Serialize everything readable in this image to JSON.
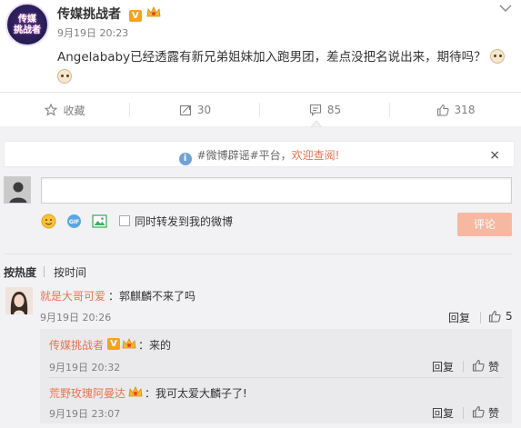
{
  "post": {
    "avatar_text_line1": "传媒",
    "avatar_text_line2": "挑战者",
    "author": "传媒挑战者",
    "verified_badge": "V",
    "time": "9月19日 20:23",
    "text": "Angelababy已经透露有新兄弟姐妹加入跑男团，差点没把名说出来，期待吗？",
    "menu_icon": "chevron-down-icon"
  },
  "actions": {
    "favorite_label": "收藏",
    "repost_count": "30",
    "comment_count": "85",
    "like_count": "318"
  },
  "comments_panel": {
    "rumor_notice_prefix": "#微博辟谣#平台，",
    "rumor_notice_link": "欢迎查阅!",
    "close_icon": "×",
    "input_value": "",
    "repost_checkbox_label": "同时转发到我的微博",
    "submit_label": "评论",
    "sort_hot": "按热度",
    "sort_time": "按时间"
  },
  "comments": [
    {
      "user": "就是大哥可爱",
      "text": "：郭麒麟不来了吗",
      "time": "9月19日 20:26",
      "reply_label": "回复",
      "likes": "5",
      "replies": [
        {
          "user": "传媒挑战者",
          "badge": "V",
          "text": "：来的",
          "time": "9月19日 20:32",
          "reply_label": "回复",
          "like_label": "赞"
        },
        {
          "user": "荒野玫瑰阿曼达",
          "badge": "",
          "text": "：我可太爱大麟子了!",
          "time": "9月19日 23:07",
          "reply_label": "回复",
          "like_label": "赞"
        }
      ]
    }
  ],
  "colors": {
    "accent_orange": "#eb7350",
    "badge_gold": "#f7a21b",
    "submit_disabled": "#f7b8a1",
    "panel_bg": "#f2f2f5"
  }
}
